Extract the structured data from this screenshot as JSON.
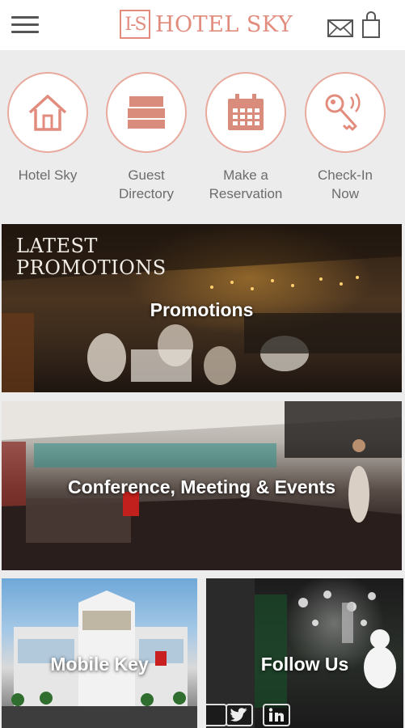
{
  "app": {
    "brand_mark": "I-S",
    "brand_name": "HOTEL SKY"
  },
  "header": {
    "menu_icon": "hamburger-menu-icon",
    "mail_icon": "envelope-icon",
    "bag_icon": "shopping-bag-icon"
  },
  "quick_actions": [
    {
      "label": "Hotel Sky",
      "icon": "home-icon"
    },
    {
      "label": "Guest\nDirectory",
      "icon": "bed-icon"
    },
    {
      "label": "Make a\nReservation",
      "icon": "calendar-icon"
    },
    {
      "label": "Check-In\nNow",
      "icon": "key-icon"
    }
  ],
  "tiles": {
    "promotions": {
      "label": "Promotions",
      "headline": "LATEST\nPROMOTIONS"
    },
    "conference": {
      "label": "Conference, Meeting & Events"
    },
    "mobile_key": {
      "label": "Mobile Key"
    },
    "follow_us": {
      "label": "Follow Us"
    }
  },
  "colors": {
    "accent": "#e28c7e",
    "circle_border": "#e9a99d",
    "label_gray": "#6c6c6c"
  }
}
